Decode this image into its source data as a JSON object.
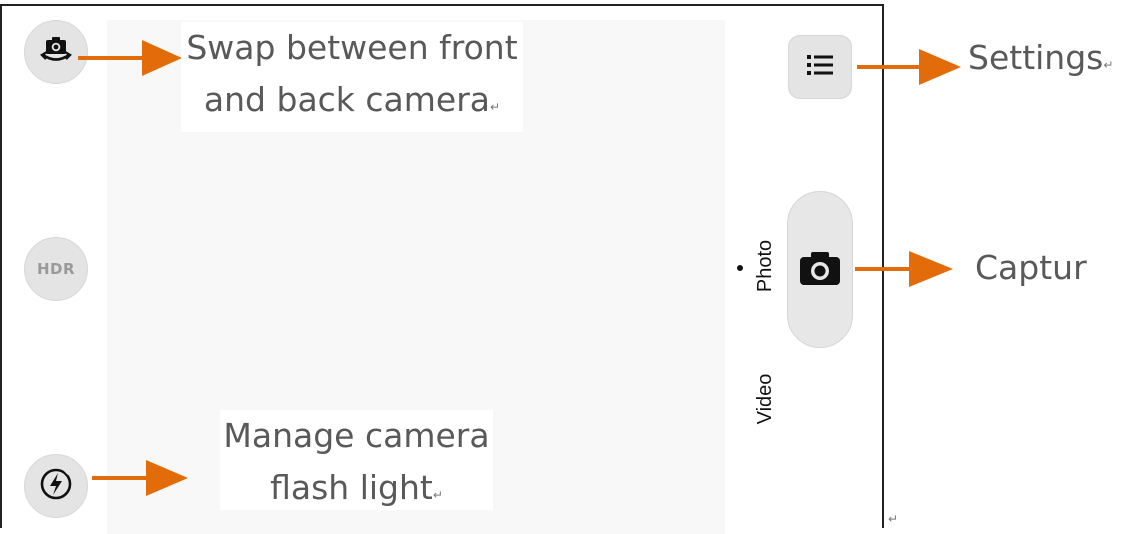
{
  "camera": {
    "viewfinder": "camera-viewfinder",
    "controls": {
      "switch_camera_icon": "camera-switch-icon",
      "hdr_label": "HDR",
      "flash_icon": "flash-auto-icon",
      "settings_icon": "menu-list-icon",
      "capture_icon": "camera-icon"
    },
    "modes": {
      "photo": "Photo",
      "video": "Video",
      "selected": "Photo"
    }
  },
  "annotations": {
    "swap_camera": {
      "line1": "Swap between front",
      "line2": "and back camera",
      "mark": "↵"
    },
    "flash": {
      "line1": "Manage camera",
      "line2": "flash light",
      "mark": "↵"
    },
    "settings": {
      "text": "Settings",
      "mark": "↵"
    },
    "capture": {
      "text": "Captur"
    },
    "end_mark": "↵"
  },
  "colors": {
    "arrow": "#E36C0A",
    "button_bg": "#E4E4E4",
    "viewfinder_bg": "#F8F8F8",
    "annotation_text": "#595959"
  }
}
